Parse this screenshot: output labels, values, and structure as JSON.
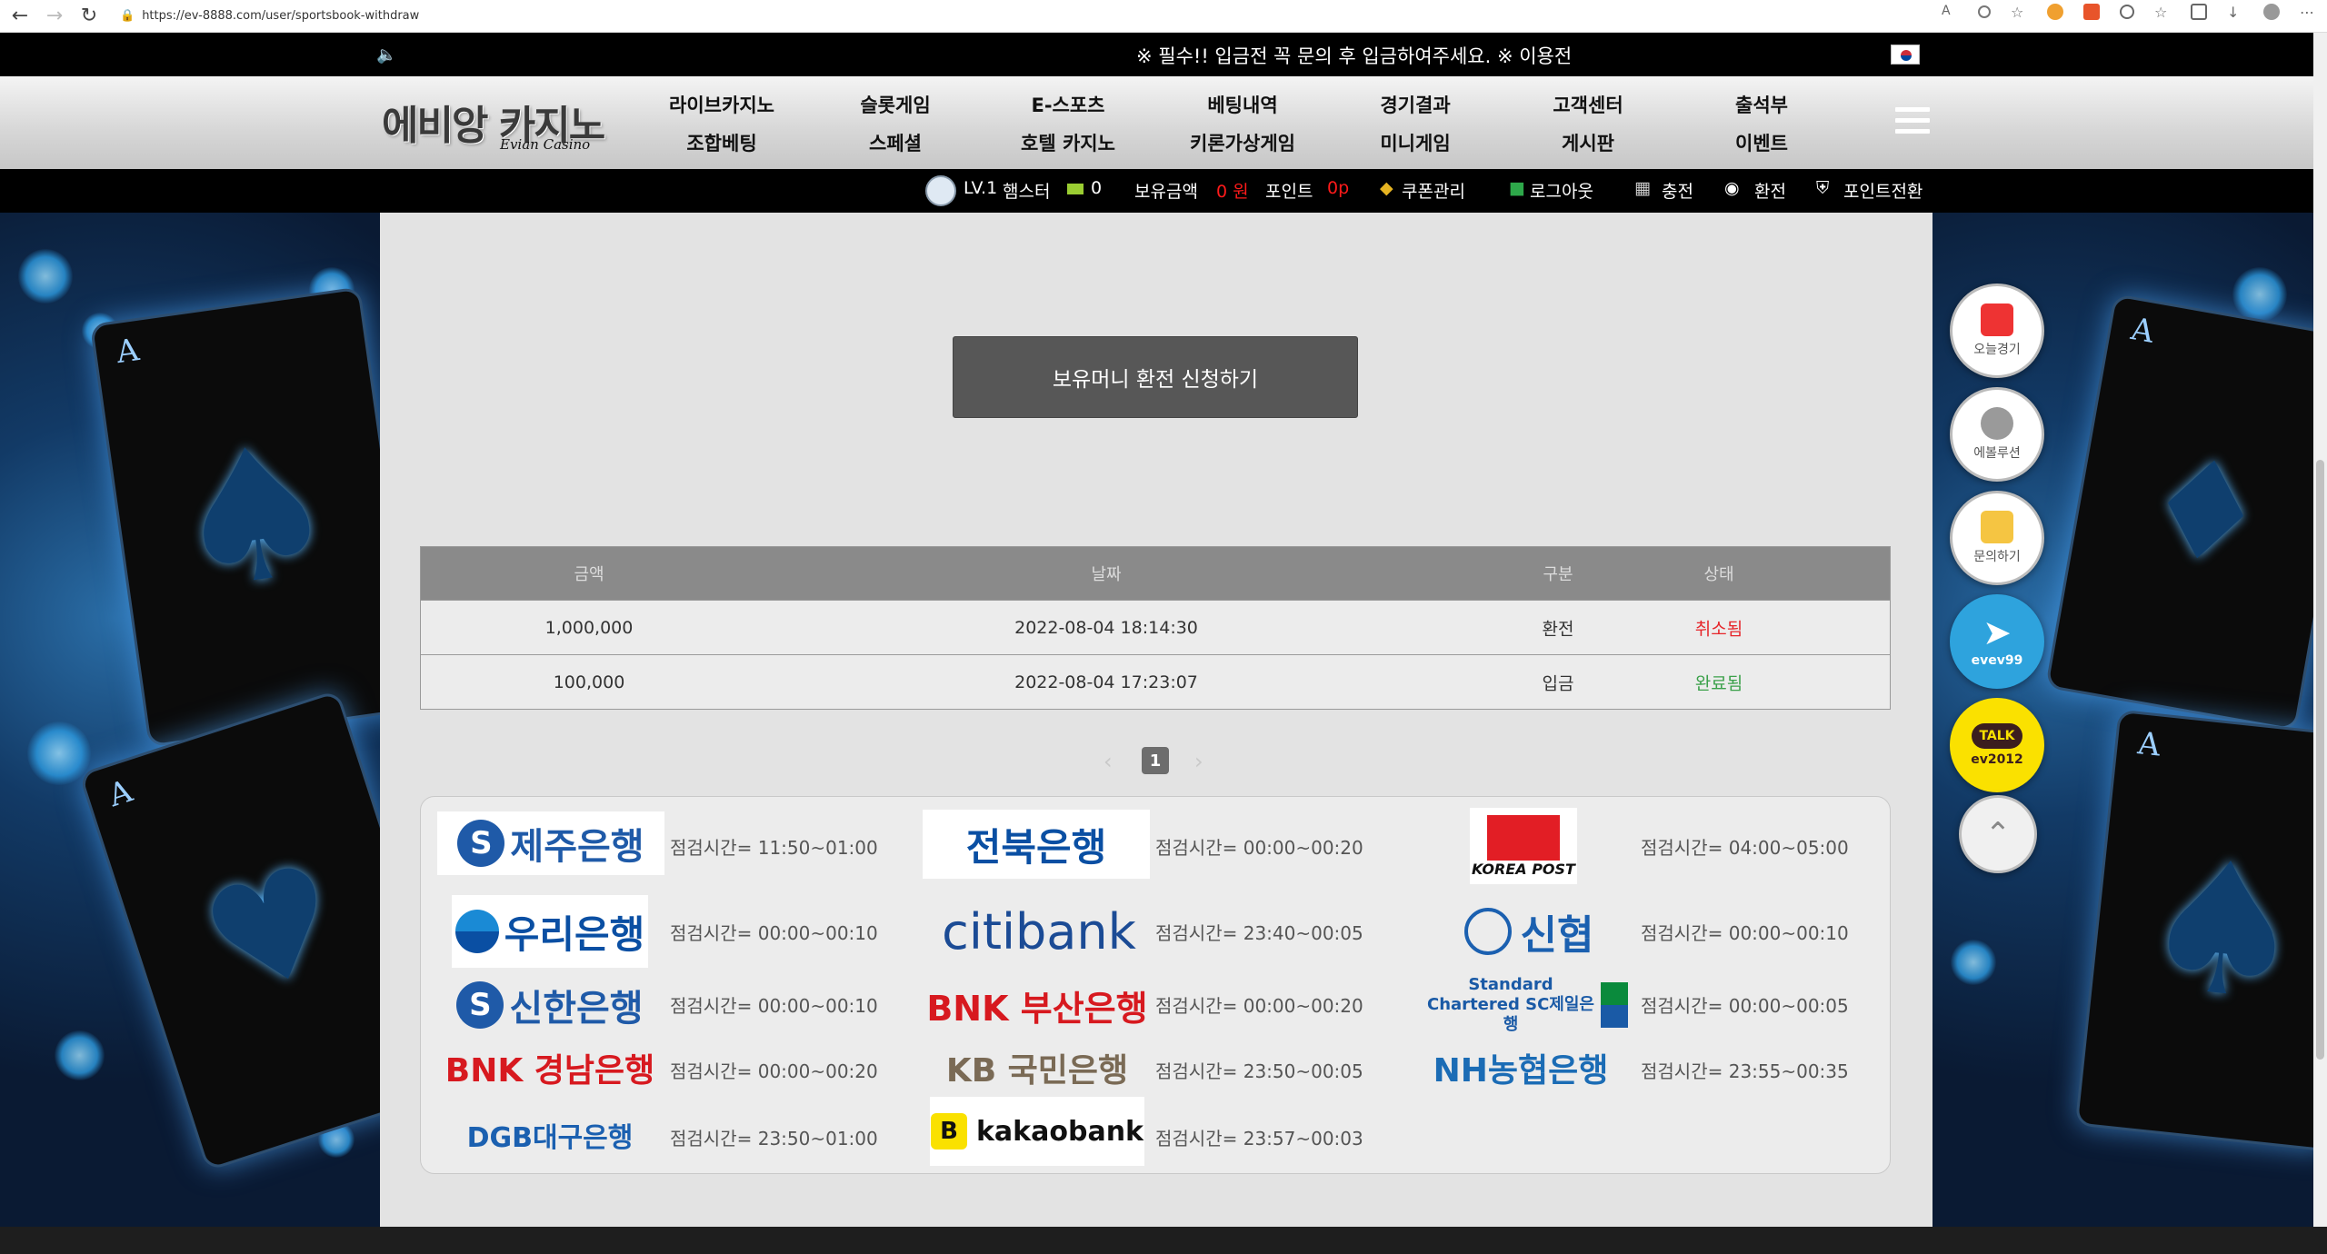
{
  "browser": {
    "url": "https://ev-8888.com/user/sportsbook-withdraw"
  },
  "notice": {
    "text": "※ 필수!! 입금전 꼭 문의 후 입금하여주세요. ※ 이용전"
  },
  "logo": {
    "main": "에비앙 카지노",
    "sub": "Evian Casino"
  },
  "menu": {
    "row1": [
      "라이브카지노",
      "슬롯게임",
      "E-스포츠",
      "베팅내역",
      "경기결과",
      "고객센터",
      "출석부"
    ],
    "row2": [
      "조합베팅",
      "스페셜",
      "호텔 카지노",
      "키론가상게임",
      "미니게임",
      "게시판",
      "이벤트"
    ]
  },
  "user": {
    "level": "LV.1",
    "name": "햄스터",
    "messages": "0",
    "balance_label": "보유금액",
    "balance": "0 원",
    "point_label": "포인트",
    "point": "0p",
    "coupon": "쿠폰관리",
    "logout": "로그아웃",
    "deposit": "충전",
    "withdraw": "환전",
    "point_convert": "포인트전환"
  },
  "withdraw_button": "보유머니 환전 신청하기",
  "history": {
    "headers": [
      "금액",
      "날짜",
      "구분",
      "상태"
    ],
    "rows": [
      {
        "amount": "1,000,000",
        "date": "2022-08-04 18:14:30",
        "type": "환전",
        "status": "취소됨"
      },
      {
        "amount": "100,000",
        "date": "2022-08-04 17:23:07",
        "type": "입금",
        "status": "완료됨"
      }
    ]
  },
  "pagination": {
    "current": "1",
    "prev": "‹",
    "next": "›"
  },
  "banks": [
    {
      "name": "제주은행",
      "time": "점검시간= 11:50~01:00"
    },
    {
      "name": "전북은행",
      "time": "점검시간= 00:00~00:20"
    },
    {
      "name": "KOREA POST",
      "time": "점검시간= 04:00~05:00"
    },
    {
      "name": "우리은행",
      "time": "점검시간= 00:00~00:10"
    },
    {
      "name": "citibank",
      "time": "점검시간= 23:40~00:05"
    },
    {
      "name": "신협",
      "time": "점검시간= 00:00~00:10"
    },
    {
      "name": "신한은행",
      "time": "점검시간= 00:00~00:10"
    },
    {
      "name": "BNK 부산은행",
      "time": "점검시간= 00:00~00:20"
    },
    {
      "name": "Standard Chartered SC제일은행",
      "time": "점검시간= 00:00~00:05"
    },
    {
      "name": "BNK 경남은행",
      "time": "점검시간= 00:00~00:20"
    },
    {
      "name": "KB 국민은행",
      "time": "점검시간= 23:50~00:05"
    },
    {
      "name": "NH농협은행",
      "time": "점검시간= 23:55~00:35"
    },
    {
      "name": "DGB대구은행",
      "time": "점검시간= 23:50~01:00"
    },
    {
      "name": "kakaobank",
      "time": "점검시간= 23:57~00:03"
    }
  ],
  "floating": {
    "today": "오늘경기",
    "evolution": "에볼루션",
    "inquiry": "문의하기",
    "telegram": "evev99",
    "kakao_talk": "TALK",
    "kakao": "ev2012"
  },
  "colors": {
    "cancel": "#e6262b",
    "complete": "#3ba14a",
    "telegram": "#2ea3dd",
    "kakao": "#fae100"
  }
}
